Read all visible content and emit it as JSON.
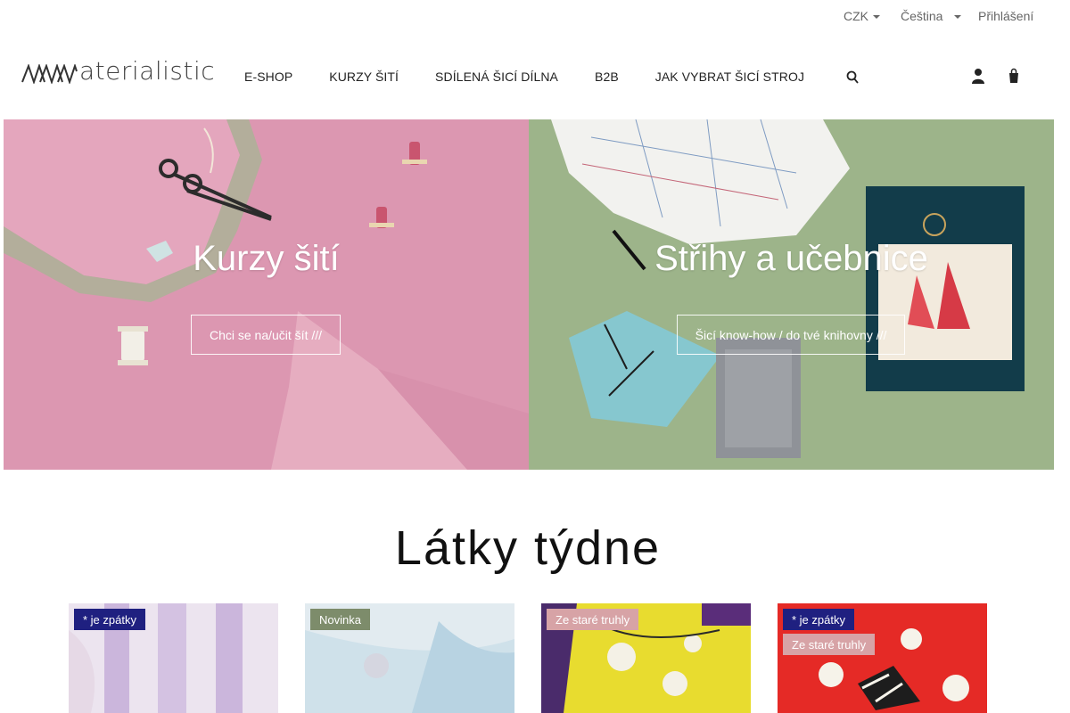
{
  "topbar": {
    "currency": "CZK",
    "language": "Čeština",
    "login": "Přihlášení"
  },
  "header": {
    "logo_text": "aterialistic",
    "nav": [
      "E-SHOP",
      "KURZY ŠITÍ",
      "SDÍLENÁ ŠICÍ DÍLNA",
      "B2B",
      "JAK VYBRAT ŠICÍ STROJ"
    ],
    "icons": [
      "search-icon",
      "user-icon",
      "cart-icon"
    ]
  },
  "hero": {
    "left": {
      "title": "Kurzy šití",
      "cta": "Chci se na/učit šít ///",
      "bg": "#dc97b1"
    },
    "right": {
      "title": "Střihy a učebnice",
      "cta": "Šicí know-how / do tvé knihovny ///",
      "bg": "#9db48a"
    }
  },
  "section": {
    "title": "Látky týdne"
  },
  "products": [
    {
      "badges": [
        "* je zpátky"
      ]
    },
    {
      "badges": [
        "Novinka"
      ]
    },
    {
      "badges": [
        "Ze staré truhly"
      ]
    },
    {
      "badges": [
        "* je zpátky",
        "Ze staré truhly"
      ]
    }
  ],
  "colors": {
    "badge_back": "#1f2080",
    "badge_new": "#7d8c6b",
    "badge_old": "#d7a3a6"
  }
}
